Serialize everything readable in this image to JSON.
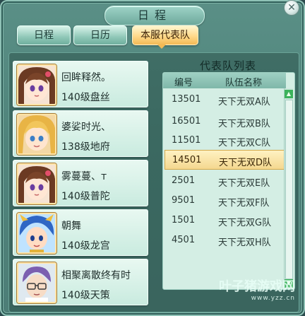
{
  "window": {
    "title": "日程",
    "close_label": "✕"
  },
  "tabs": [
    {
      "label": "日程",
      "active": false
    },
    {
      "label": "日历",
      "active": false
    },
    {
      "label": "本服代表队",
      "active": true
    }
  ],
  "players": [
    {
      "name": "回眸释然。",
      "level": "140级盘丝",
      "avatar": "female-brown-hair-avatar"
    },
    {
      "name": "婆娑时光、",
      "level": "138级地府",
      "avatar": "blonde-character-avatar"
    },
    {
      "name": "雾蔓蔓、ᴛ",
      "level": "140级普陀",
      "avatar": "female-brown-hair-avatar"
    },
    {
      "name": "朝舞",
      "level": "140级龙宫",
      "avatar": "blue-dragon-boy-avatar"
    },
    {
      "name": "相聚离散终有时",
      "level": "140级天策",
      "avatar": "glasses-man-avatar"
    }
  ],
  "team_list": {
    "title": "代表队列表",
    "col_id": "编号",
    "col_name": "队伍名称",
    "selected_index": 3,
    "rows": [
      {
        "id": "13501",
        "name": "天下无双A队"
      },
      {
        "id": "16501",
        "name": "天下无双B队"
      },
      {
        "id": "11501",
        "name": "天下无双C队"
      },
      {
        "id": "14501",
        "name": "天下无双D队"
      },
      {
        "id": "2501",
        "name": "天下无双E队"
      },
      {
        "id": "9501",
        "name": "天下无双F队"
      },
      {
        "id": "1501",
        "name": "天下无双G队"
      },
      {
        "id": "4501",
        "name": "天下无双H队"
      }
    ],
    "scroll_up": "▲",
    "scroll_down": "▼"
  },
  "watermark": {
    "main": "叶子猪游戏网",
    "sub": "www.yzz.cn"
  },
  "colors": {
    "accent": "#f2b955",
    "panel": "#4f847b",
    "selected_row": "#f4d88f"
  }
}
